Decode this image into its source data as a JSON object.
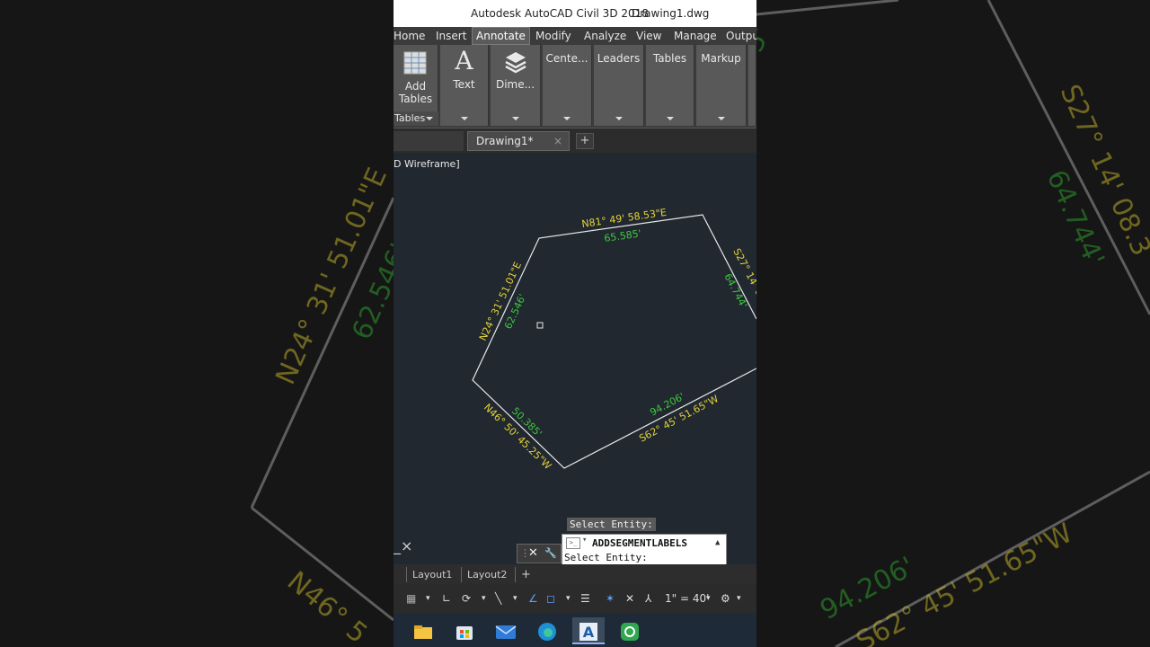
{
  "app": {
    "title": "Autodesk AutoCAD Civil 3D 2018",
    "file": "Drawing1.dwg"
  },
  "menu": [
    "Home",
    "Insert",
    "Annotate",
    "Modify",
    "Analyze",
    "View",
    "Manage",
    "Output"
  ],
  "menu_active": "Annotate",
  "ribbon": {
    "add_tables_line1": "Add",
    "add_tables_line2": "Tables",
    "tables_panel": "Tables",
    "text_label": "Text",
    "dimension_label": "Dime...",
    "panels": [
      "Cente...",
      "Leaders",
      "Tables",
      "Markup"
    ]
  },
  "doc_tab": {
    "label": "Drawing1*",
    "close": "×",
    "new": "+"
  },
  "viewport": {
    "label": "D Wireframe]",
    "bearings": {
      "top": "N81° 49' 58.53\"E",
      "right": "S27° 14' 08.3",
      "left": "N24° 31' 51.01\"E",
      "bottom_left": "N46° 50' 45.25\"W",
      "bottom_right": "S62° 45' 51.65\"W"
    },
    "distances": {
      "top": "65.585'",
      "right": "64.744'",
      "left": "62.546'",
      "bottom_left": "50.385'",
      "bottom_right": "94.206'"
    },
    "close_icon_text": "_×",
    "colors": {
      "bearing": "#e3d23a",
      "distance": "#3ec63e",
      "line": "#e8e8e8"
    }
  },
  "command": {
    "prompt_label": "Select Entity:",
    "command_name": "ADDSEGMENTLABELS",
    "command_line": "Select Entity:",
    "tool_close": "✕",
    "tool_wrench": "🔧"
  },
  "layouts": [
    "Layout1",
    "Layout2"
  ],
  "layout_add": "+",
  "status": {
    "scale": "1\" = 40'"
  },
  "background": {
    "bearing_left": "N24° 31' 51.01\"E",
    "distance_left": "62.546'",
    "bearing_right": "S27° 14' 08.3",
    "distance_right": "64.744'",
    "distance_bottom": "94.206'",
    "bearing_bottom": "S62° 45' 51.65\"W",
    "bearing_bottom_left": "N46° 5",
    "distance_top_fragment": "5'"
  }
}
